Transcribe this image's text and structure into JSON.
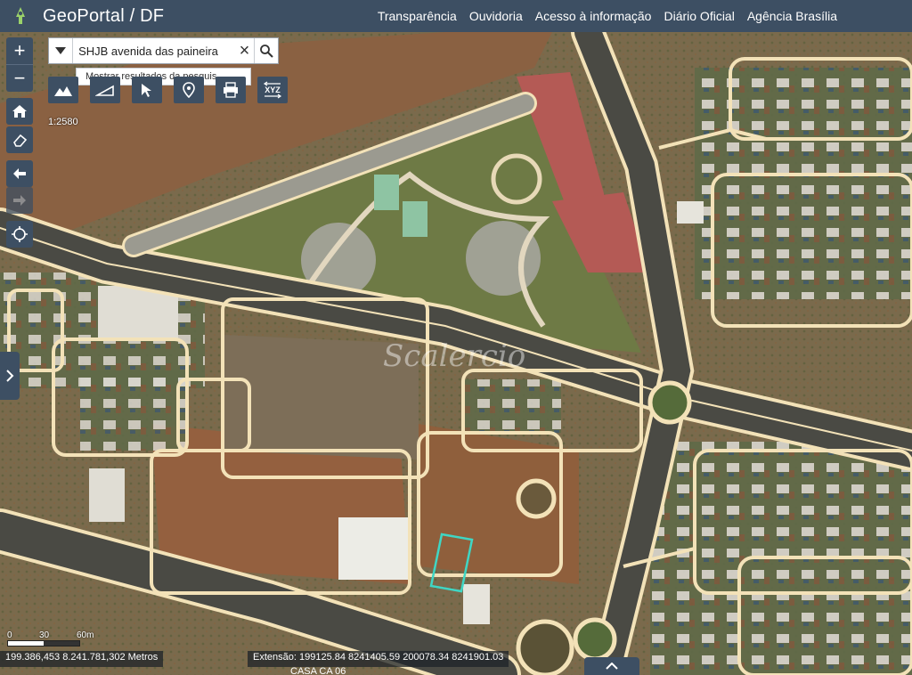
{
  "header": {
    "app_title": "GeoPortal / DF",
    "nav": [
      "Transparência",
      "Ouvidoria",
      "Acesso à informação",
      "Diário Oficial",
      "Agência Brasília"
    ]
  },
  "search": {
    "value": "SHJB avenida das paineira",
    "suggestion": "Mostrar resultados da pesquis..."
  },
  "map": {
    "scale_ratio": "1:2580",
    "scale_labels": [
      "0",
      "30",
      "60m"
    ],
    "cursor_coords": "199.386,453 8.241.781,302 Metros",
    "extent": "Extensão: 199125.84 8241405.59 200078.34 8241901.03",
    "watermark": "Scalercio",
    "street_label": "CASA CA 06"
  },
  "icons": {
    "logo": "geoportal-logo-icon",
    "zoom_in": "plus-icon",
    "zoom_out": "minus-icon",
    "home": "home-icon",
    "eraser": "eraser-icon",
    "back": "arrow-left-icon",
    "forward": "arrow-right-icon",
    "locate": "locate-icon",
    "dropdown": "caret-down-icon",
    "clear": "close-icon",
    "search": "search-icon",
    "tools": [
      "basemap-icon",
      "measure-icon",
      "identify-icon",
      "location-icon",
      "print-icon",
      "xyz-icon"
    ],
    "side_panel": "chevron-right-icon",
    "bottom_panel": "chevron-up-icon"
  },
  "colors": {
    "header_bg": "#3d4f63",
    "road_outline": "#f3e2b8",
    "selected_parcel": "#3fd6c4"
  }
}
